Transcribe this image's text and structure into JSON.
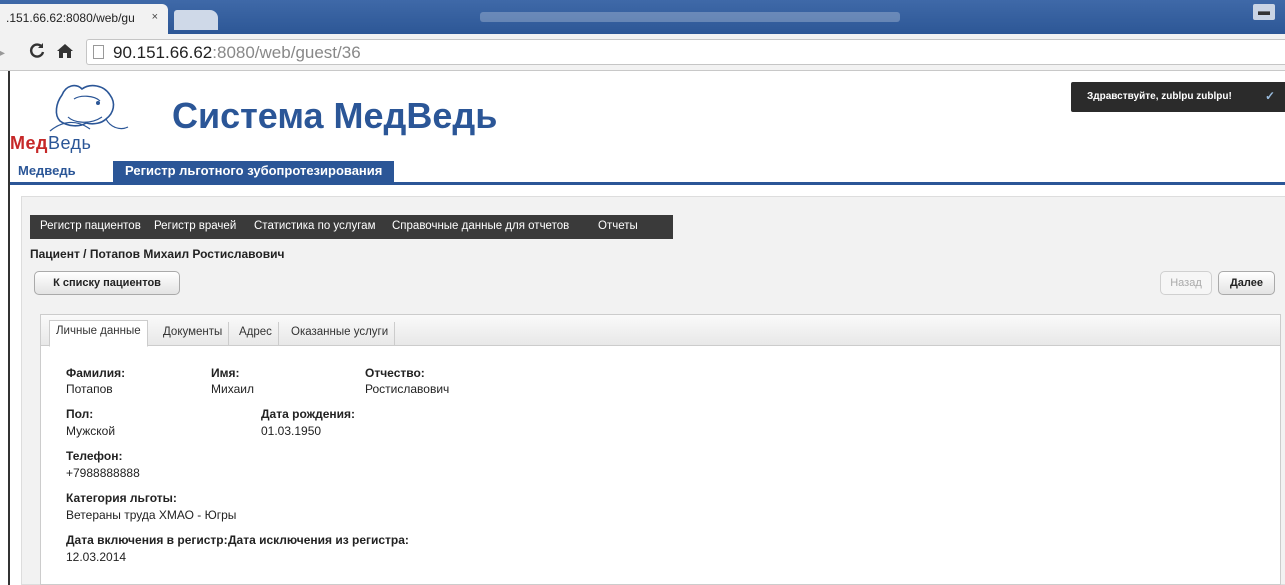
{
  "browser": {
    "tab_title": ".151.66.62:8080/web/gu",
    "tab_close": "×",
    "url_host": "90.151.66.62",
    "url_path": ":8080/web/guest/36"
  },
  "header": {
    "logo_part1": "Мед",
    "logo_part2": "Ведь",
    "site_title": "Система МедВедь",
    "greeting": "Здравствуйте, zublpu zublpu!"
  },
  "topnav": {
    "items": [
      {
        "label": "Медведь"
      },
      {
        "label": "Регистр льготного зубопротезирования"
      }
    ]
  },
  "submenu": {
    "items": [
      {
        "label": "Регистр пациентов"
      },
      {
        "label": "Регистр врачей"
      },
      {
        "label": "Статистика по услугам"
      },
      {
        "label": "Справочные данные для отчетов"
      },
      {
        "label": "Отчеты"
      }
    ]
  },
  "breadcrumb": "Пациент / Потапов Михаил Ростиславович",
  "buttons": {
    "back_to_list": "К списку пациентов",
    "back": "Назад",
    "next": "Далее"
  },
  "tabs": [
    {
      "label": "Личные данные",
      "active": true
    },
    {
      "label": "Документы",
      "active": false
    },
    {
      "label": "Адрес",
      "active": false
    },
    {
      "label": "Оказанные услуги",
      "active": false
    }
  ],
  "patient": {
    "last_name_label": "Фамилия:",
    "last_name": "Потапов",
    "first_name_label": "Имя:",
    "first_name": "Михаил",
    "patronymic_label": "Отчество:",
    "patronymic": "Ростиславович",
    "gender_label": "Пол:",
    "gender": "Мужской",
    "birth_label": "Дата рождения:",
    "birth_date": "01.03.1950",
    "phone_label": "Телефон:",
    "phone": "+7988888888",
    "benefit_label": "Категория льготы:",
    "benefit": "Ветераны труда ХМАО - Югры",
    "included_label": "Дата включения в регистр:",
    "included_date": "12.03.2014",
    "excluded_label": "Дата исключения из регистра:"
  },
  "colors": {
    "brand_blue": "#2b5697",
    "logo_red": "#c62828",
    "submenu_bg": "#3a3a3a"
  }
}
